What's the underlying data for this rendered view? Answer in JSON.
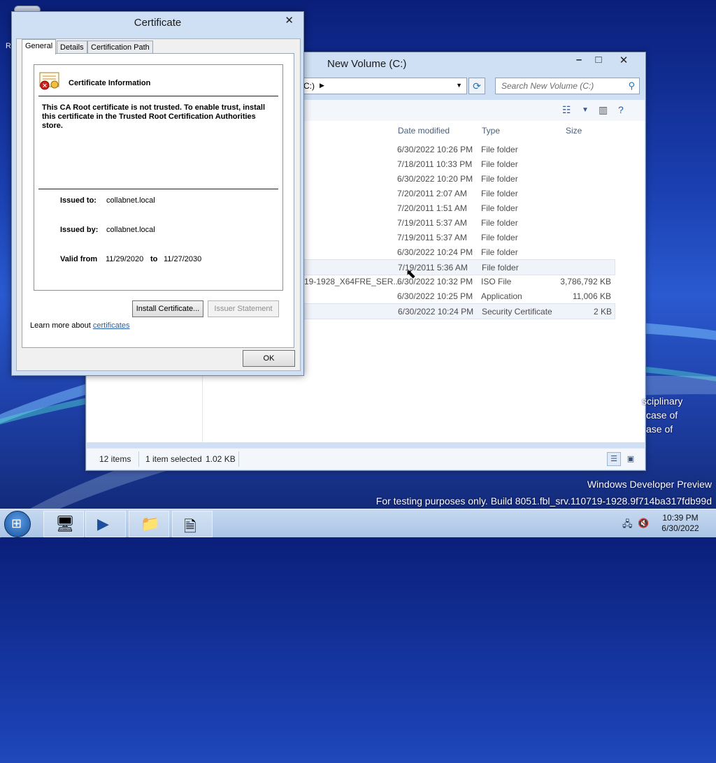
{
  "desktop": {
    "icon_fragment": "R"
  },
  "explorer": {
    "title": "New Volume (C:)",
    "address_text": "C:)",
    "search_placeholder": "Search New Volume (C:)",
    "columns": {
      "date": "Date modified",
      "type": "Type",
      "size": "Size"
    },
    "rows": [
      {
        "name": "",
        "date": "6/30/2022 10:26 PM",
        "type": "File folder",
        "size": ""
      },
      {
        "name": "",
        "date": "7/18/2011 10:33 PM",
        "type": "File folder",
        "size": ""
      },
      {
        "name": "",
        "date": "6/30/2022 10:20 PM",
        "type": "File folder",
        "size": ""
      },
      {
        "name": "",
        "date": "7/20/2011 2:07 AM",
        "type": "File folder",
        "size": ""
      },
      {
        "name": "",
        "date": "7/20/2011 1:51 AM",
        "type": "File folder",
        "size": ""
      },
      {
        "name": "",
        "date": "7/19/2011 5:37 AM",
        "type": "File folder",
        "size": ""
      },
      {
        "name": "",
        "date": "7/19/2011 5:37 AM",
        "type": "File folder",
        "size": ""
      },
      {
        "name": "",
        "date": "6/30/2022 10:24 PM",
        "type": "File folder",
        "size": ""
      },
      {
        "name": "",
        "date": "7/19/2011 5:36 AM",
        "type": "File folder",
        "size": ""
      },
      {
        "name": "19-1928_X64FRE_SER...",
        "date": "6/30/2022 10:32 PM",
        "type": "ISO File",
        "size": "3,786,792 KB"
      },
      {
        "name": "",
        "date": "6/30/2022 10:25 PM",
        "type": "Application",
        "size": "11,006 KB"
      },
      {
        "name": "",
        "date": "6/30/2022 10:24 PM",
        "type": "Security Certificate",
        "size": "2 KB"
      }
    ],
    "status": {
      "items": "12 items",
      "selected": "1 item selected",
      "size": "1.02 KB"
    }
  },
  "cert": {
    "title": "Certificate",
    "tabs": [
      "General",
      "Details",
      "Certification Path"
    ],
    "info_heading": "Certificate Information",
    "warning": "This CA Root certificate is not trusted. To enable trust, install this certificate in the Trusted Root Certification Authorities store.",
    "issued_to_label": "Issued to:",
    "issued_to": "collabnet.local",
    "issued_by_label": "Issued by:",
    "issued_by": "collabnet.local",
    "valid_from_label": "Valid from",
    "valid_from": "11/29/2020",
    "to_label": "to",
    "valid_to": "11/27/2030",
    "install_btn": "Install Certificate...",
    "issuer_btn": "Issuer Statement",
    "learn_prefix": "Learn more about ",
    "learn_link": "certificates",
    "ok_btn": "OK"
  },
  "overlay_lines": [
    "sciplinary",
    "case of",
    "ase of"
  ],
  "watermark": {
    "line1": "Windows Developer Preview",
    "line2": "For testing purposes only. Build 8051.fbl_srv.110719-1928.9f714ba317fdb99d"
  },
  "taskbar": {
    "time": "10:39 PM",
    "date": "6/30/2022"
  }
}
